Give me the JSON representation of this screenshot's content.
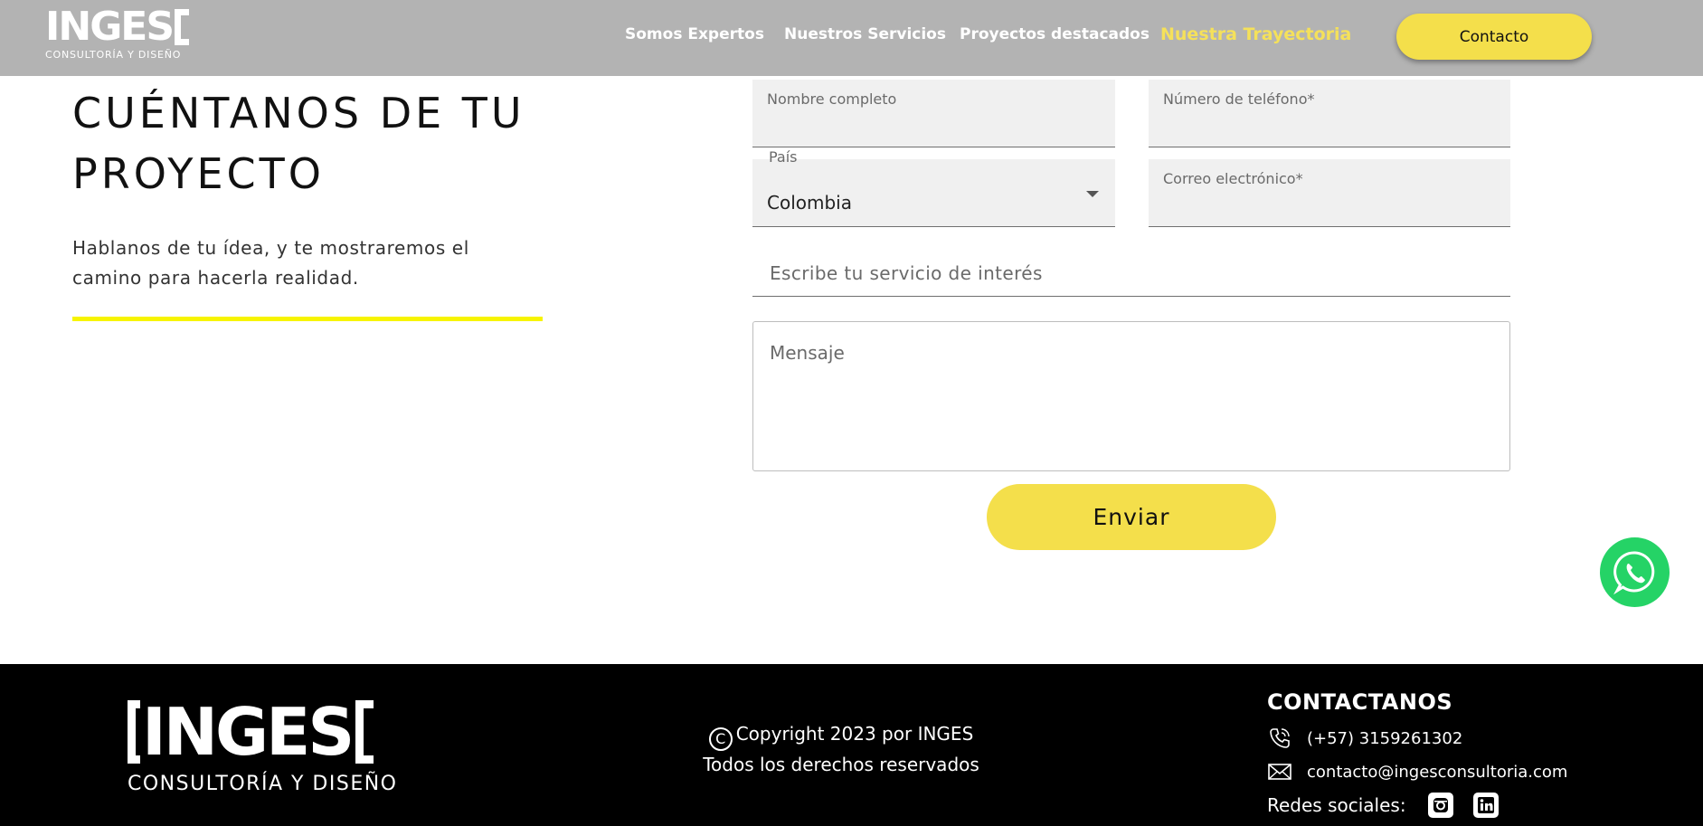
{
  "header": {
    "logo_text": "INGES",
    "logo_subtitle": "CONSULTORÍA Y DISEÑO",
    "nav": [
      {
        "label": "Somos Expertos"
      },
      {
        "label": "Nuestros Servicios"
      },
      {
        "label": "Proyectos destacados"
      },
      {
        "label": "Nuestra Trayectoria",
        "active": true
      }
    ],
    "contact_button": "Contacto"
  },
  "intro": {
    "title": "CUÉNTANOS DE TU PROYECTO",
    "text": "Hablanos de tu ídea, y te mostraremos el camino para hacerla realidad."
  },
  "form": {
    "name_label": "Nombre completo",
    "phone_label": "Número de teléfono*",
    "country_label": "País",
    "country_value": "Colombia",
    "email_label": "Correo electrónico*",
    "service_placeholder": "Escribe tu servicio de interés",
    "message_placeholder": "Mensaje",
    "submit_label": "Enviar"
  },
  "footer": {
    "logo_text": "INGES",
    "logo_subtitle": "CONSULTORÍA Y DISEÑO",
    "copyright_symbol": "C",
    "copyright_line1": "Copyright 2023 por INGES",
    "copyright_line2": "Todos los derechos reservados",
    "contact_heading": "CONTACTANOS",
    "phone": "(+57) 3159261302",
    "email": "contacto@ingesconsultoria.com",
    "social_label": "Redes sociales:"
  },
  "colors": {
    "header_bg": "#b3b3b3",
    "accent_yellow": "#f4df4b",
    "active_nav": "#f5e15a",
    "divider_yellow": "#f7f400",
    "whatsapp": "#25d366",
    "footer_bg": "#000000"
  },
  "icons": [
    "whatsapp-icon",
    "copyright-icon",
    "phone-icon",
    "mail-icon",
    "instagram-icon",
    "linkedin-icon",
    "chevron-down-icon"
  ]
}
